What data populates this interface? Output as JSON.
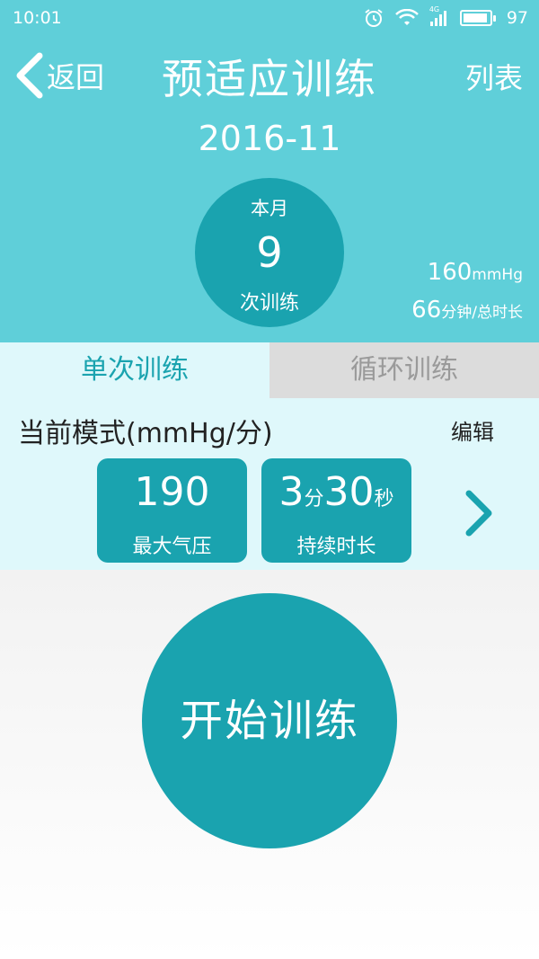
{
  "status_bar": {
    "time": "10:01",
    "network": "4G",
    "battery": "97"
  },
  "nav": {
    "back_label": "返回",
    "title": "预适应训练",
    "list_label": "列表"
  },
  "month": "2016-11",
  "summary": {
    "label": "本月",
    "count": "9",
    "unit": "次训练"
  },
  "stats": {
    "pressure_value": "160",
    "pressure_unit": "mmHg",
    "duration_value": "66",
    "duration_unit": "分钟/总时长"
  },
  "tabs": [
    {
      "label": "单次训练",
      "active": true
    },
    {
      "label": "循环训练",
      "active": false
    }
  ],
  "mode": {
    "title": "当前模式(mmHg/分)",
    "edit_label": "编辑",
    "cards": [
      {
        "value": "190",
        "label": "最大气压"
      },
      {
        "minutes": "3",
        "minutes_unit": "分",
        "seconds": "30",
        "seconds_unit": "秒",
        "label": "持续时长"
      }
    ]
  },
  "start_label": "开始训练",
  "colors": {
    "header": "#5fcfd9",
    "accent": "#1aa3af",
    "panel": "#dff8fb"
  }
}
